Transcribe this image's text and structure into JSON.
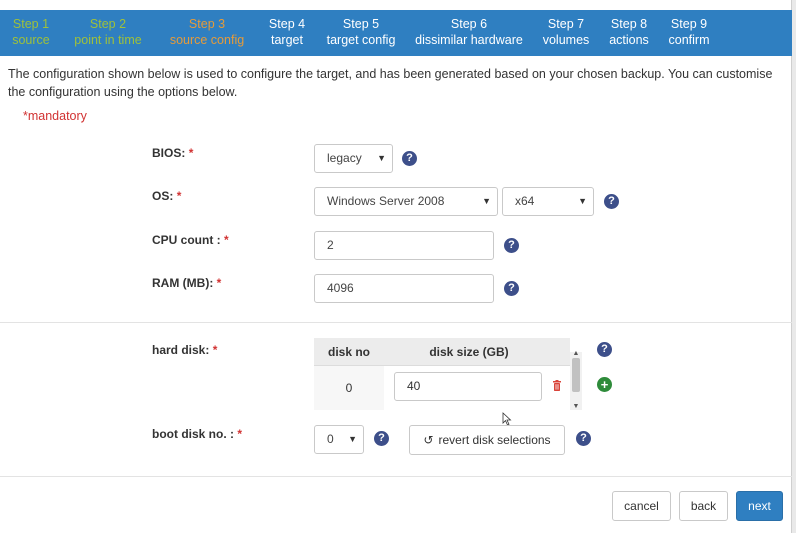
{
  "steps": [
    {
      "num": "Step 1",
      "name": "source",
      "state": "done"
    },
    {
      "num": "Step 2",
      "name": "point in time",
      "state": "done"
    },
    {
      "num": "Step 3",
      "name": "source config",
      "state": "current"
    },
    {
      "num": "Step 4",
      "name": "target",
      "state": "todo"
    },
    {
      "num": "Step 5",
      "name": "target config",
      "state": "todo"
    },
    {
      "num": "Step 6",
      "name": "dissimilar hardware",
      "state": "todo"
    },
    {
      "num": "Step 7",
      "name": "volumes",
      "state": "todo"
    },
    {
      "num": "Step 8",
      "name": "actions",
      "state": "todo"
    },
    {
      "num": "Step 9",
      "name": "confirm",
      "state": "todo"
    }
  ],
  "intro": "The configuration shown below is used to configure the target, and has been generated based on your chosen backup. You can customise the configuration using the options below.",
  "mandatory": "*mandatory",
  "form": {
    "bios_label": "BIOS:",
    "bios_value": "legacy",
    "os_label": "OS:",
    "os_value": "Windows Server 2008",
    "arch_value": "x64",
    "cpu_label": "CPU count :",
    "cpu_value": "2",
    "ram_label": "RAM (MB):",
    "ram_value": "4096",
    "hard_disk_label": "hard disk:",
    "boot_disk_label": "boot disk no. :",
    "boot_disk_value": "0",
    "required_marker": "*"
  },
  "disk_table": {
    "col_no": "disk no",
    "col_size": "disk size (GB)",
    "rows": [
      {
        "no": "0",
        "size": "40"
      }
    ]
  },
  "buttons": {
    "revert": "revert disk selections",
    "cancel": "cancel",
    "back": "back",
    "next": "next"
  },
  "icons": {
    "help": "question-circle-icon",
    "add": "plus-circle-icon",
    "delete": "trash-icon",
    "revert": "undo-icon"
  },
  "colors": {
    "accent": "#2f7fc1",
    "step_done": "#9fc13a",
    "step_current": "#e59b3a",
    "required": "#d13232"
  }
}
